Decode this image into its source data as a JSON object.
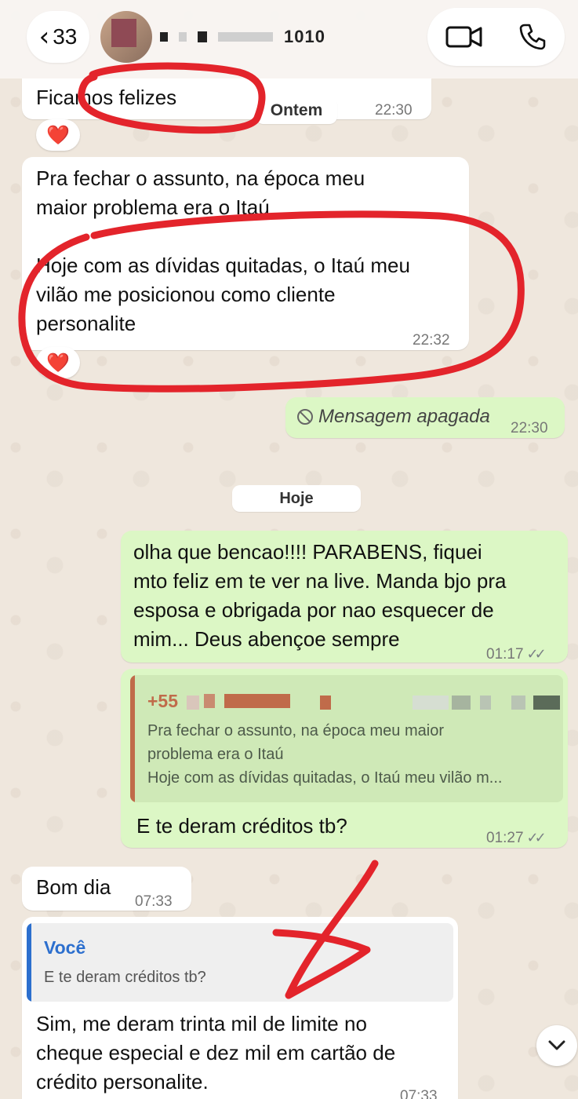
{
  "header": {
    "back_count": "33",
    "contact_number_partial": "1010"
  },
  "messages": {
    "m1_text": "Ficamos felizes",
    "m1_time": "22:30",
    "m1_reaction": "❤️",
    "date_yesterday": "Ontem",
    "m2_text": "Pra fechar o assunto, na época meu\nmaior problema era o Itaú\n\nHoje com as dívidas quitadas, o Itaú meu\nvilão me posicionou como cliente\npersonalite",
    "m2_time": "22:32",
    "m2_reaction": "❤️",
    "m3_text": "Mensagem apagada",
    "m3_time": "22:30",
    "date_today": "Hoje",
    "m4_text": "olha que bencao!!!! PARABENS, fiquei\nmto feliz em te ver na live. Manda bjo pra\nesposa e obrigada por nao esquecer de\nmim... Deus abençoe sempre",
    "m4_time": "01:17",
    "m5_quote_author": "+55",
    "m5_quote_text": "Pra fechar o assunto, na época meu maior\nproblema era o Itaú\nHoje com as dívidas quitadas, o Itaú meu vilão m...",
    "m5_text": "E te deram créditos tb?",
    "m5_time": "01:27",
    "m6_text": "Bom dia",
    "m6_time": "07:33",
    "m7_quote_author": "Você",
    "m7_quote_text": "E te deram créditos tb?",
    "m7_text": "Sim, me deram trinta mil de limite no\ncheque especial e dez mil em cartão de\ncrédito personalite.",
    "m7_time": "07:33"
  },
  "colors": {
    "incoming_bubble": "#ffffff",
    "outgoing_bubble": "#dcf7c5",
    "annotation_red": "#e3242b",
    "quote_out_accent": "#c06b4a",
    "quote_in_accent": "#2c6fce"
  },
  "icons": {
    "back": "chevron-left-icon",
    "video": "video-camera-icon",
    "phone": "phone-icon",
    "deleted": "block-icon",
    "read": "double-check-icon",
    "scroll": "chevron-down-icon"
  }
}
